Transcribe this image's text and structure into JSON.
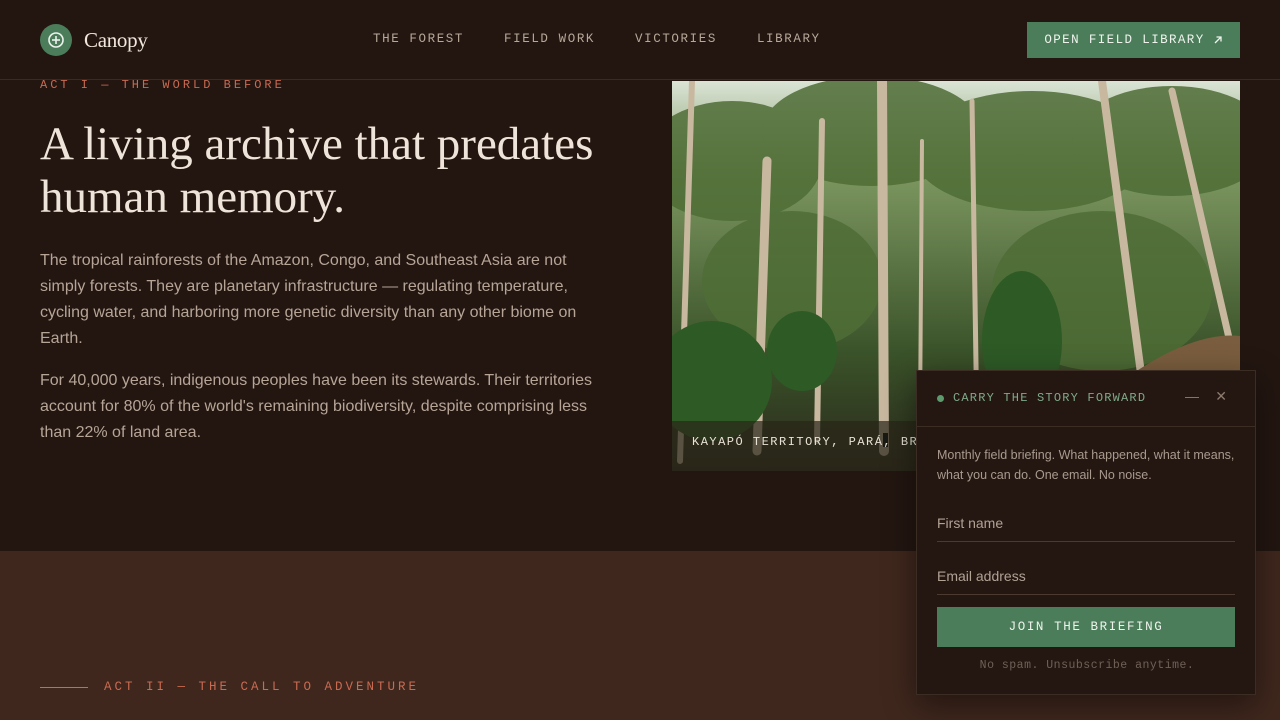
{
  "header": {
    "brand": "Canopy",
    "nav": [
      "THE FOREST",
      "FIELD WORK",
      "VICTORIES",
      "LIBRARY"
    ],
    "cta_label": "OPEN FIELD LIBRARY",
    "cta_icon": "arrow-up-right-icon"
  },
  "scroll_progress": 0.195,
  "hero": {
    "eyebrow": "ACT I — THE WORLD BEFORE",
    "title": "A living archive that predates human memory.",
    "paragraphs": [
      "The tropical rainforests of the Amazon, Congo, and Southeast Asia are not simply forests. They are planetary infrastructure — regulating temperature, cycling water, and harboring more genetic diversity than any other biome on Earth.",
      "For 40,000 years, indigenous peoples have been its stewards. Their territories account for 80% of the world's remaining biodiversity, despite comprising less than 22% of land area."
    ],
    "photo_caption": "KAYAPÓ TERRITORY, PARÁ, BRAZIL"
  },
  "next_section": {
    "eyebrow": "ACT II — THE CALL TO ADVENTURE"
  },
  "newsletter": {
    "title": "CARRY THE STORY FORWARD",
    "minimize_label": "—",
    "close_label": "✕",
    "description": "Monthly field briefing. What happened, what it means, what you can do. One email. No noise.",
    "first_name_placeholder": "First name",
    "email_placeholder": "Email address",
    "submit_label": "JOIN THE BRIEFING",
    "note": "No spam. Unsubscribe anytime."
  },
  "colors": {
    "background": "#231611",
    "accent_green": "#4c7d5a",
    "accent_terracotta": "#c96a52",
    "lower_section": "#3f271d"
  }
}
